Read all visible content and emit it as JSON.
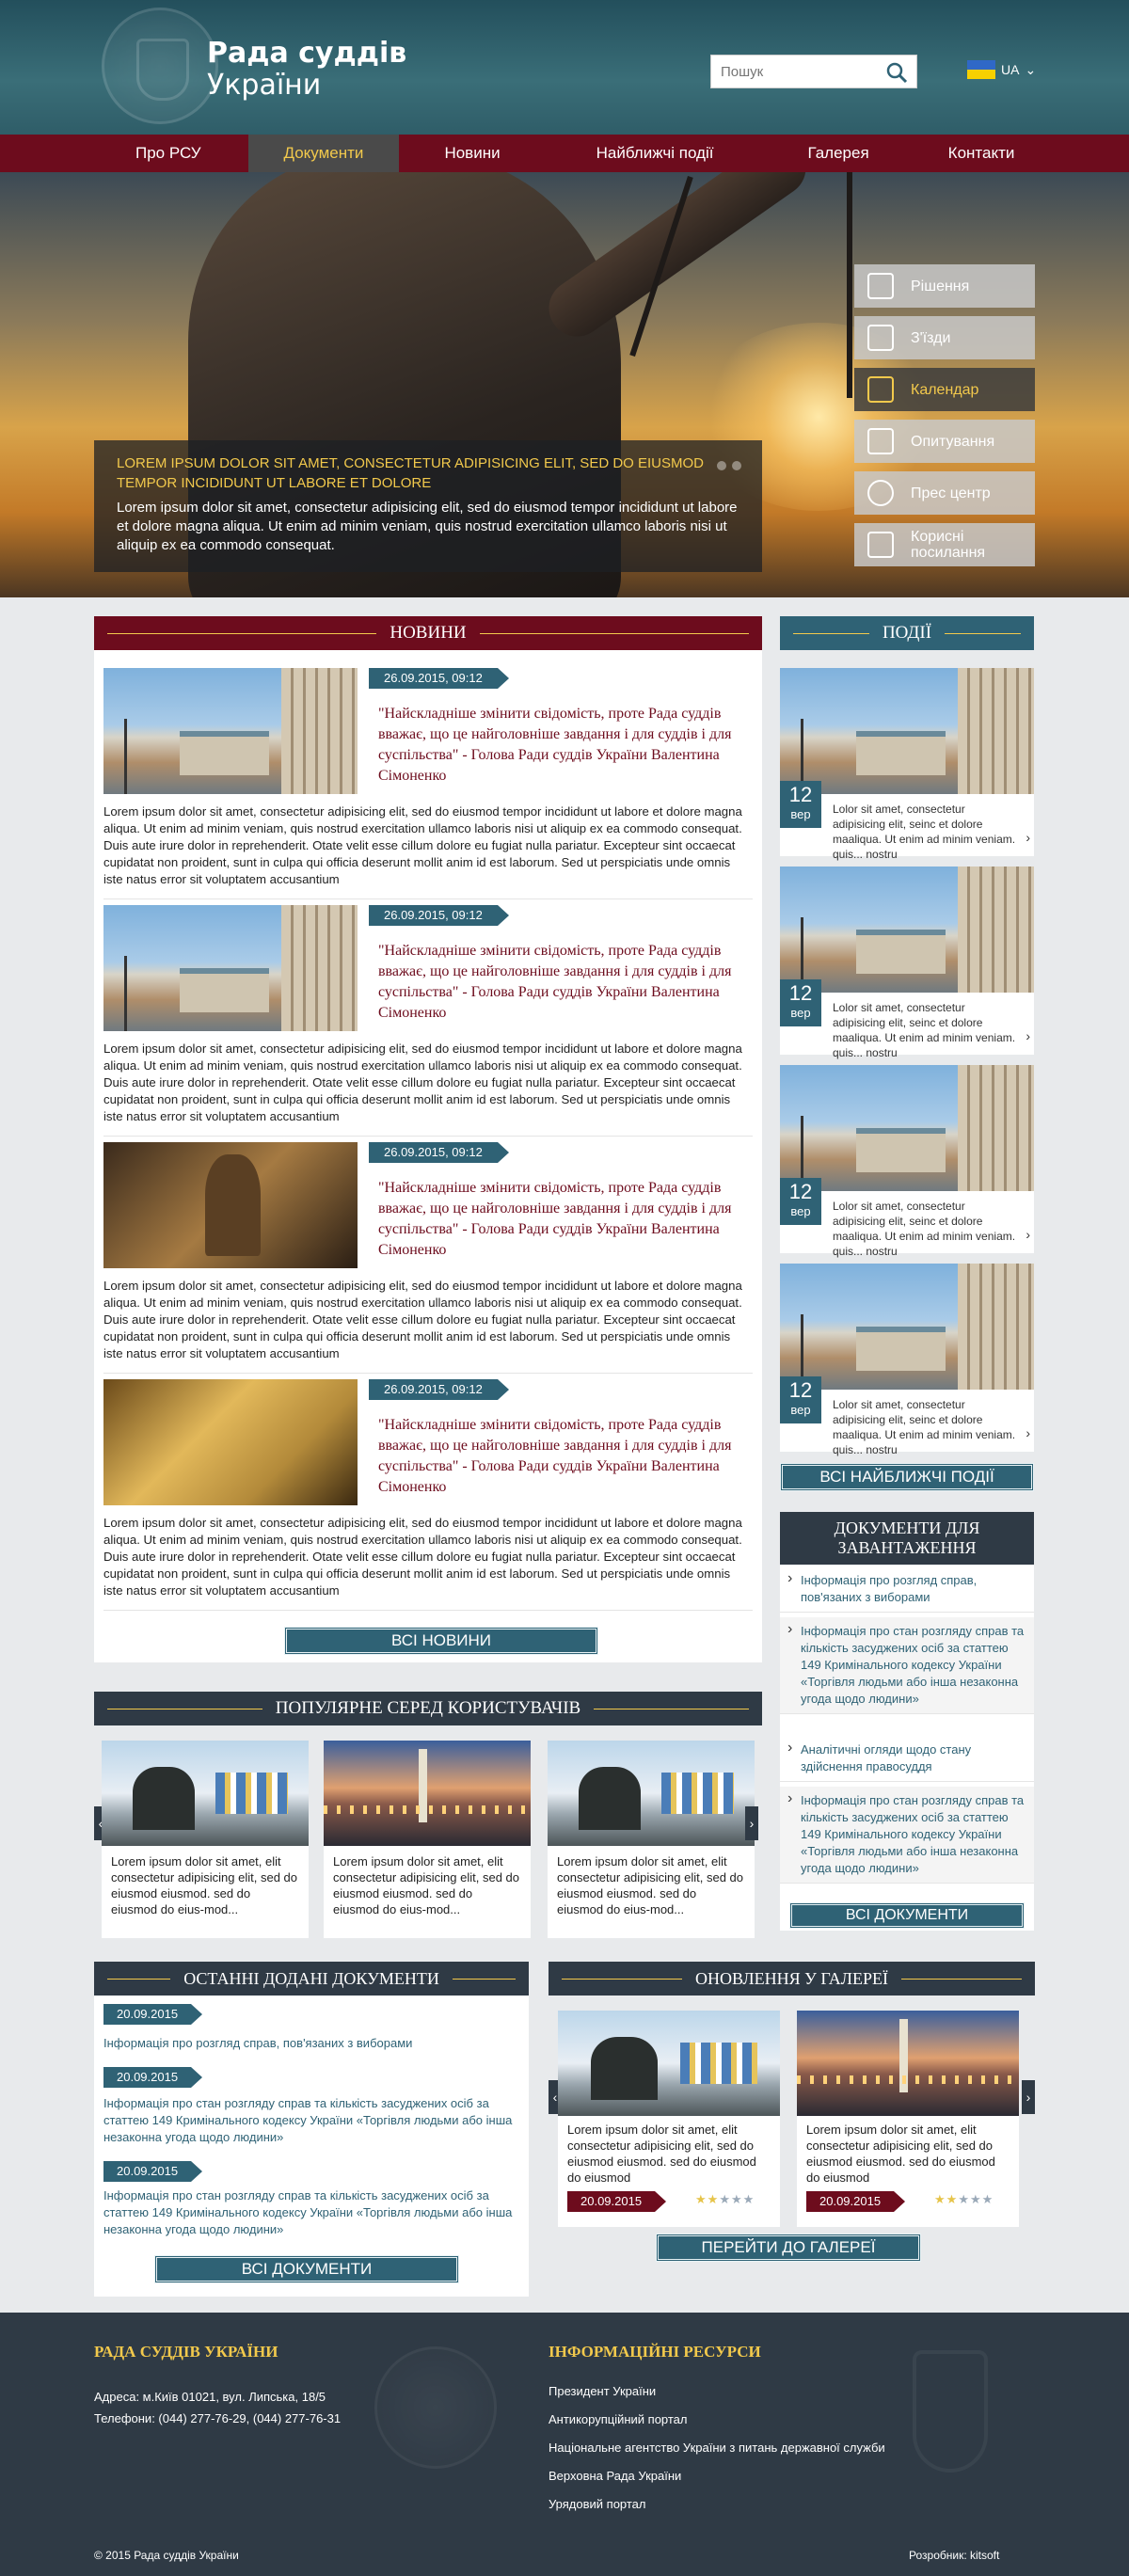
{
  "header": {
    "title_line1": "Рада суддів",
    "title_line2": "України",
    "search_placeholder": "Пошук",
    "lang": "UA"
  },
  "nav": [
    "Про РСУ",
    "Документи",
    "Новини",
    "Найближчі події",
    "Галерея",
    "Контакти"
  ],
  "hero": {
    "title": "Lorem ipsum dolor sit amet, consectetur adipisicing elit, sed do eiusmod tempor incididunt ut labore et dolore",
    "text": "Lorem ipsum dolor sit amet, consectetur adipisicing elit, sed do eiusmod tempor incididunt ut labore et dolore magna aliqua. Ut enim ad minim veniam, quis nostrud exercitation ullamco laboris nisi ut aliquip ex ea commodo consequat."
  },
  "quick_links": [
    "Рішення",
    "З'їзди",
    "Календар",
    "Опитування",
    "Прес центр",
    "Корисні посилання"
  ],
  "news": {
    "heading": "НОВИНИ",
    "items": [
      {
        "date": "26.09.2015, 09:12",
        "title": "\"Найскладніше змінити свідомість, проте Рада суддів вважає, що це найголовніше завдання і для суддів і для суспільства\" - Голова Ради суддів України Валентина Сімоненко",
        "text": "Lorem ipsum dolor sit amet, consectetur adipisicing elit, sed do eiusmod tempor incididunt ut labore et dolore magna aliqua. Ut enim ad minim veniam, quis nostrud exercitation ullamco laboris nisi ut aliquip ex ea commodo consequat. Duis aute irure dolor in reprehenderit. Otate velit esse cillum dolore eu fugiat nulla pariatur. Excepteur sint occaecat cupidatat non proident, sunt in culpa qui officia deserunt mollit anim id est laborum. Sed ut perspiciatis unde omnis iste natus error sit voluptatem accusantium"
      },
      {
        "date": "26.09.2015, 09:12",
        "title": "\"Найскладніше змінити свідомість, проте Рада суддів вважає, що це найголовніше завдання і для суддів і для суспільства\" - Голова Ради суддів України Валентина Сімоненко",
        "text": "Lorem ipsum dolor sit amet, consectetur adipisicing elit, sed do eiusmod tempor incididunt ut labore et dolore magna aliqua. Ut enim ad minim veniam, quis nostrud exercitation ullamco laboris nisi ut aliquip ex ea commodo consequat. Duis aute irure dolor in reprehenderit. Otate velit esse cillum dolore eu fugiat nulla pariatur. Excepteur sint occaecat cupidatat non proident, sunt in culpa qui officia deserunt mollit anim id est laborum. Sed ut perspiciatis unde omnis iste natus error sit voluptatem accusantium"
      },
      {
        "date": "26.09.2015, 09:12",
        "title": "\"Найскладніше змінити свідомість, проте Рада суддів вважає, що це найголовніше завдання і для суддів і для суспільства\" - Голова Ради суддів України Валентина Сімоненко",
        "text": "Lorem ipsum dolor sit amet, consectetur adipisicing elit, sed do eiusmod tempor incididunt ut labore et dolore magna aliqua. Ut enim ad minim veniam, quis nostrud exercitation ullamco laboris nisi ut aliquip ex ea commodo consequat. Duis aute irure dolor in reprehenderit. Otate velit esse cillum dolore eu fugiat nulla pariatur. Excepteur sint occaecat cupidatat non proident, sunt in culpa qui officia deserunt mollit anim id est laborum. Sed ut perspiciatis unde omnis iste natus error sit voluptatem accusantium"
      },
      {
        "date": "26.09.2015, 09:12",
        "title": "\"Найскладніше змінити свідомість, проте Рада суддів вважає, що це найголовніше завдання і для суддів і для суспільства\" - Голова Ради суддів України Валентина Сімоненко",
        "text": "Lorem ipsum dolor sit amet, consectetur adipisicing elit, sed do eiusmod tempor incididunt ut labore et dolore magna aliqua. Ut enim ad minim veniam, quis nostrud exercitation ullamco laboris nisi ut aliquip ex ea commodo consequat. Duis aute irure dolor in reprehenderit. Otate velit esse cillum dolore eu fugiat nulla pariatur. Excepteur sint occaecat cupidatat non proident, sunt in culpa qui officia deserunt mollit anim id est laborum. Sed ut perspiciatis unde omnis iste natus error sit voluptatem accusantium"
      }
    ],
    "all_button": "ВСІ НОВИНИ"
  },
  "events": {
    "heading": "ПОДІЇ",
    "items": [
      {
        "day": "12",
        "month": "вер",
        "text": "Lolor sit amet, consectetur adipisicing elit, seinc et dolore maaliqua. Ut enim ad minim veniam. quis... nostru"
      },
      {
        "day": "12",
        "month": "вер",
        "text": "Lolor sit amet, consectetur adipisicing elit, seinc et dolore maaliqua. Ut enim ad minim veniam. quis... nostru"
      },
      {
        "day": "12",
        "month": "вер",
        "text": "Lolor sit amet, consectetur adipisicing elit, seinc et dolore maaliqua. Ut enim ad minim veniam. quis... nostru"
      },
      {
        "day": "12",
        "month": "вер",
        "text": "Lolor sit amet, consectetur adipisicing elit, seinc et dolore maaliqua. Ut enim ad minim veniam. quis... nostru"
      }
    ],
    "all_button": "ВСІ НАЙБЛИЖЧІ ПОДІЇ"
  },
  "downloads": {
    "heading": "ДОКУМЕНТИ ДЛЯ ЗАВАНТАЖЕННЯ",
    "items": [
      "Інформація про розгляд справ, пов'язаних з виборами",
      "Інформація про стан розгляду справ та кількість засуджених осіб за статтею 149 Кримінального кодексу України «Торгівля людьми або інша незаконна угода щодо людини»",
      "Аналітичні огляди щодо стану здійснення правосуддя",
      "Інформація про стан розгляду справ та кількість засуджених осіб за статтею 149 Кримінального кодексу України «Торгівля людьми або інша незаконна угода щодо людини»"
    ],
    "all_button": "ВСІ ДОКУМЕНТИ"
  },
  "popular": {
    "heading": "ПОПУЛЯРНЕ СЕРЕД КОРИСТУВАЧІВ",
    "items": [
      "Lorem ipsum dolor sit amet, elit consectetur adipisicing elit, sed do eiusmod eiusmod. sed do eiusmod do eius-mod...",
      "Lorem ipsum dolor sit amet, elit consectetur adipisicing elit, sed do eiusmod eiusmod. sed do eiusmod do eius-mod...",
      "Lorem ipsum dolor sit amet, elit consectetur adipisicing elit, sed do eiusmod eiusmod. sed do eiusmod do eius-mod..."
    ]
  },
  "recent_docs": {
    "heading": "ОСТАННІ ДОДАНІ ДОКУМЕНТИ",
    "items": [
      {
        "date": "20.09.2015",
        "text": "Інформація про розгляд справ, пов'язаних з виборами"
      },
      {
        "date": "20.09.2015",
        "text": "Інформація про стан розгляду справ та кількість засуджених осіб за статтею 149 Кримінального кодексу України «Торгівля людьми або інша незаконна угода щодо людини»"
      },
      {
        "date": "20.09.2015",
        "text": "Інформація про стан розгляду справ та кількість засуджених осіб за статтею 149 Кримінального кодексу України «Торгівля людьми або інша незаконна угода щодо людини»"
      }
    ],
    "all_button": "ВСІ ДОКУМЕНТИ"
  },
  "gallery": {
    "heading": "ОНОВЛЕННЯ У ГАЛЕРЕЇ",
    "items": [
      {
        "text": "Lorem ipsum dolor sit amet, elit consectetur adipisicing elit, sed do eiusmod eiusmod. sed do eiusmod do eiusmod",
        "date": "20.09.2015",
        "rating": 2
      },
      {
        "text": "Lorem ipsum dolor sit amet, elit consectetur adipisicing elit, sed do eiusmod eiusmod. sed do eiusmod do eiusmod",
        "date": "20.09.2015",
        "rating": 2
      }
    ],
    "button": "ПЕРЕЙТИ ДО ГАЛЕРЕЇ"
  },
  "footer": {
    "org_title": "РАДА СУДДІВ УКРАЇНИ",
    "address": "Адреса: м.Київ 01021, вул. Липська, 18/5",
    "phones": "Телефони: (044) 277-76-29, (044) 277-76-31",
    "resources_title": "ІНФОРМАЦІЙНІ РЕСУРСИ",
    "links": [
      "Президент України",
      "Антикорупційний портал",
      "Національне агентство України з питань державної служби",
      "Верховна Рада України",
      "Урядовий портал"
    ],
    "copyright": "© 2015  Рада суддів України",
    "developer": "Розробник: kitsoft"
  },
  "colors": {
    "primary_red": "#6d0c1d",
    "teal": "#2f6275",
    "dark": "#2f3a45",
    "gold": "#f2c94c"
  }
}
